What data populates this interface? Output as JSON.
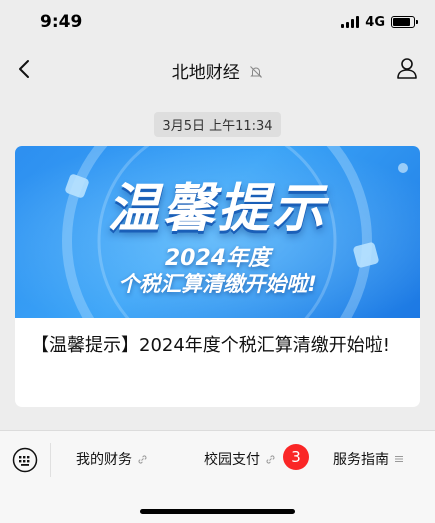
{
  "status_bar": {
    "time": "9:49",
    "network": "4G"
  },
  "nav": {
    "title": "北地财经",
    "icons": {
      "back": "chevron-left-icon",
      "mute": "bell-off-icon",
      "profile": "person-icon"
    }
  },
  "message": {
    "timestamp": "3月5日 上午11:34",
    "banner": {
      "title": "温馨提示",
      "year_line": "2024年度",
      "subtitle": "个税汇算清缴开始啦!"
    },
    "article_title": "【温馨提示】2024年度个税汇算清缴开始啦!"
  },
  "bottom_menu": {
    "items": [
      {
        "label": "我的财务",
        "icon": "link-icon"
      },
      {
        "label": "校园支付",
        "icon": "link-icon"
      },
      {
        "label": "服务指南",
        "icon": "menu-lines-icon"
      }
    ],
    "badge": "3"
  },
  "colors": {
    "background": "#ededed",
    "banner_blue": "#2d8ff0",
    "badge_red": "#fa2626"
  }
}
